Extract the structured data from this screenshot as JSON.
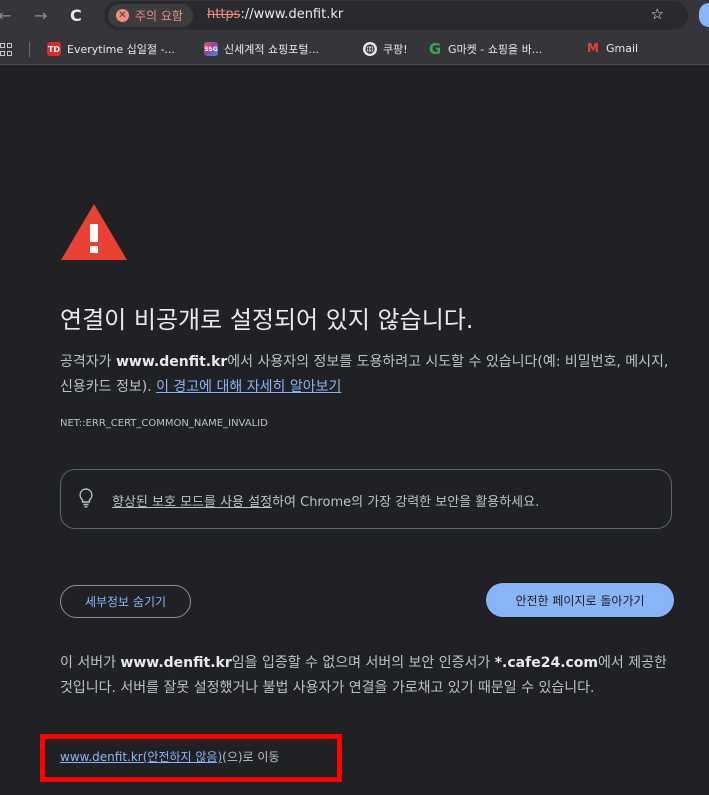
{
  "browser": {
    "back_icon": "←",
    "forward_icon": "→",
    "reload_icon": "C",
    "security_chip": "주의 요함",
    "url_protocol": "https",
    "url_rest": "://www.denfit.kr",
    "star_icon": "☆"
  },
  "bookmarks": [
    {
      "label": "Everytime 십일절 -...",
      "icon_text": "TD",
      "color": "#e02a2a"
    },
    {
      "label": "신세계적 쇼핑포털...",
      "icon_text": "SSG",
      "color": "#8e44ad"
    },
    {
      "label": "쿠팡!",
      "icon_text": "",
      "color": "#e8eaed"
    },
    {
      "label": "G마켓 - 쇼핑을 바...",
      "icon_text": "G",
      "color": "#35363a"
    },
    {
      "label": "Gmail",
      "icon_text": "M",
      "color": "#35363a"
    }
  ],
  "page": {
    "title": "연결이 비공개로 설정되어 있지 않습니다.",
    "desc_prefix": "공격자가 ",
    "desc_domain": "www.denfit.kr",
    "desc_suffix": "에서 사용자의 정보를 도용하려고 시도할 수 있습니다(예: 비밀번호, 메시지, 신용카드 정보). ",
    "learn_more": "이 경고에 대해 자세히 알아보기",
    "error_code": "NET::ERR_CERT_COMMON_NAME_INVALID",
    "enhanced_link": "향상된 보호 모드를 사용 설정",
    "enhanced_rest": "하여 Chrome의 가장 강력한 보안을 활용하세요.",
    "hide_details_button": "세부정보 숨기기",
    "back_to_safety_button": "안전한 페이지로 돌아가기",
    "details_prefix": "이 서버가 ",
    "details_domain": "www.denfit.kr",
    "details_mid": "임을 입증할 수 없으며 서버의 보안 인증서가 ",
    "details_cert": "*.cafe24.com",
    "details_suffix": "에서 제공한 것입니다. 서버를 잘못 설정했거나 불법 사용자가 연결을 가로채고 있기 때문일 수 있습니다.",
    "proceed_link": "www.denfit.kr(안전하지 않음)",
    "proceed_suffix": "(으)로 이동"
  },
  "colors": {
    "background": "#202124",
    "link": "#8ab4f8",
    "warning": "#e94235",
    "highlight_box": "#ff0000"
  }
}
